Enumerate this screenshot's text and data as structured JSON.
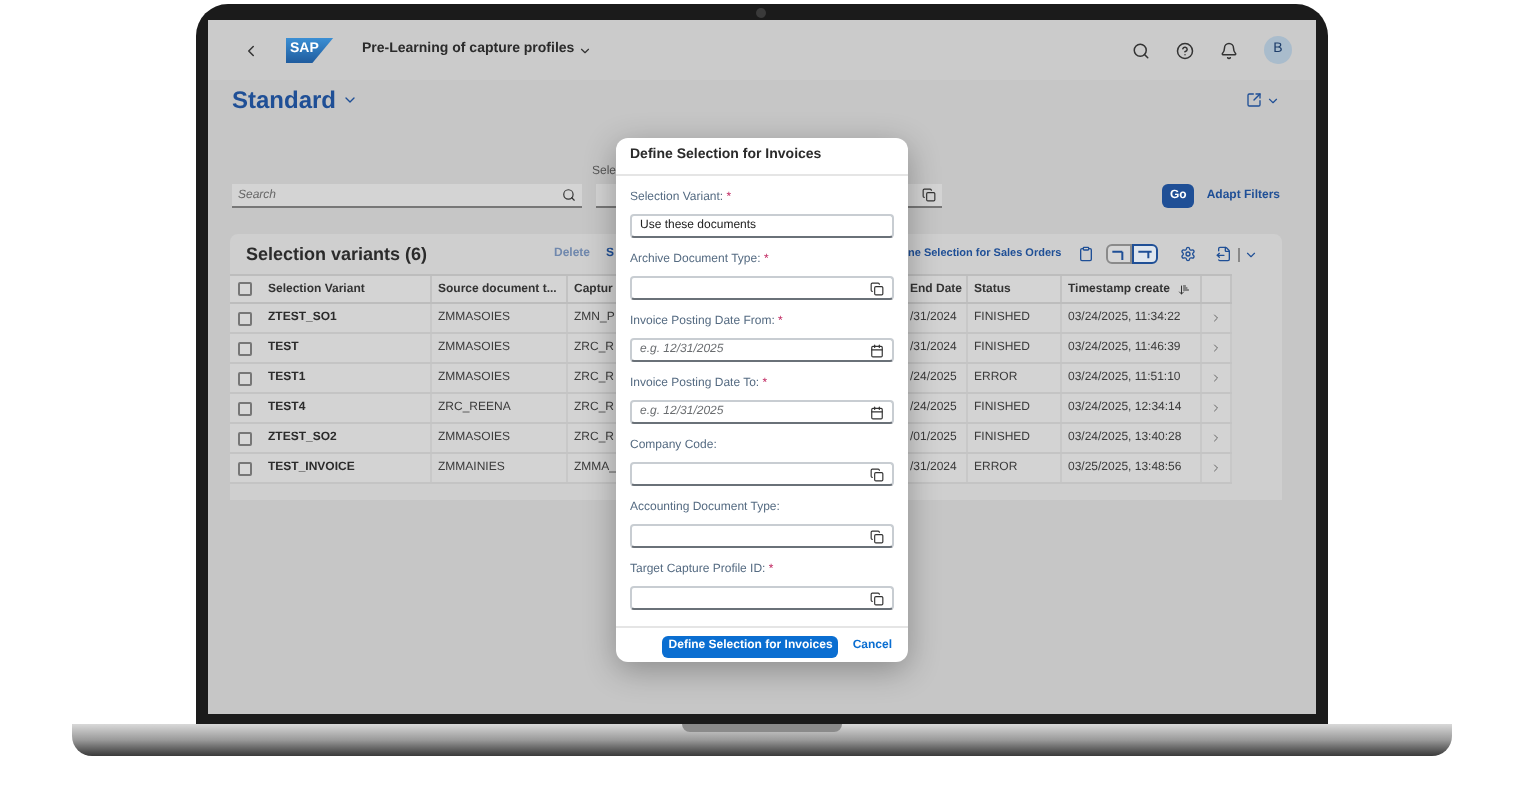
{
  "shell": {
    "logo": "SAP",
    "title": "Pre-Learning of capture profiles",
    "avatar": "B"
  },
  "page": {
    "variant": "Standard"
  },
  "filters": {
    "search": {
      "placeholder": "Search"
    },
    "field_label": "Sele",
    "go": "Go",
    "adapt": "Adapt Filters"
  },
  "table": {
    "title": "Selection variants (6)",
    "actions": [
      {
        "label": "Delete",
        "disabled": true
      },
      {
        "label": "S",
        "disabled": false
      }
    ],
    "link": "ne Selection for Sales Orders",
    "select_all": {
      "checked": false
    },
    "view_toggle": [
      {
        "selected": false
      },
      {
        "selected": true
      }
    ],
    "columns": [
      "Selection Variant",
      "Source document t...",
      "Captur",
      "End Date",
      "Status",
      "Timestamp create"
    ],
    "rows": [
      {
        "checked": false,
        "cells": [
          "ZTEST_SO1",
          "ZMMASOIES",
          "ZMN_P",
          "/31/2024",
          "FINISHED",
          "03/24/2025, 11:34:22"
        ]
      },
      {
        "checked": false,
        "cells": [
          "TEST",
          "ZMMASOIES",
          "ZRC_R",
          "/31/2024",
          "FINISHED",
          "03/24/2025, 11:46:39"
        ]
      },
      {
        "checked": false,
        "cells": [
          "TEST1",
          "ZMMASOIES",
          "ZRC_R",
          "/24/2025",
          "ERROR",
          "03/24/2025, 11:51:10"
        ]
      },
      {
        "checked": false,
        "cells": [
          "TEST4",
          "ZRC_REENA",
          "ZRC_R",
          "/24/2025",
          "FINISHED",
          "03/24/2025, 12:34:14"
        ]
      },
      {
        "checked": false,
        "cells": [
          "ZTEST_SO2",
          "ZMMASOIES",
          "ZRC_R",
          "/01/2025",
          "FINISHED",
          "03/24/2025, 13:40:28"
        ]
      },
      {
        "checked": false,
        "cells": [
          "TEST_INVOICE",
          "ZMMAINIES",
          "ZMMA_",
          "/31/2024",
          "ERROR",
          "03/25/2025, 13:48:56"
        ]
      }
    ]
  },
  "dialog": {
    "title": "Define Selection for Invoices",
    "fields": [
      {
        "label": "Selection Variant:",
        "required": true,
        "kind": "text",
        "value": "Use these documents"
      },
      {
        "label": "Archive Document Type:",
        "required": true,
        "kind": "valuehelp"
      },
      {
        "label": "Invoice Posting Date From:",
        "required": true,
        "kind": "date",
        "placeholder": "e.g. 12/31/2025"
      },
      {
        "label": "Invoice Posting Date To:",
        "required": true,
        "kind": "date",
        "placeholder": "e.g. 12/31/2025"
      },
      {
        "label": "Company Code:",
        "required": false,
        "kind": "valuehelp"
      },
      {
        "label": "Accounting Document Type:",
        "required": false,
        "kind": "valuehelp"
      },
      {
        "label": "Target Capture Profile ID:",
        "required": true,
        "kind": "valuehelp"
      }
    ],
    "required_mark": "*",
    "primary": "Define Selection for Invoices",
    "cancel": "Cancel"
  }
}
